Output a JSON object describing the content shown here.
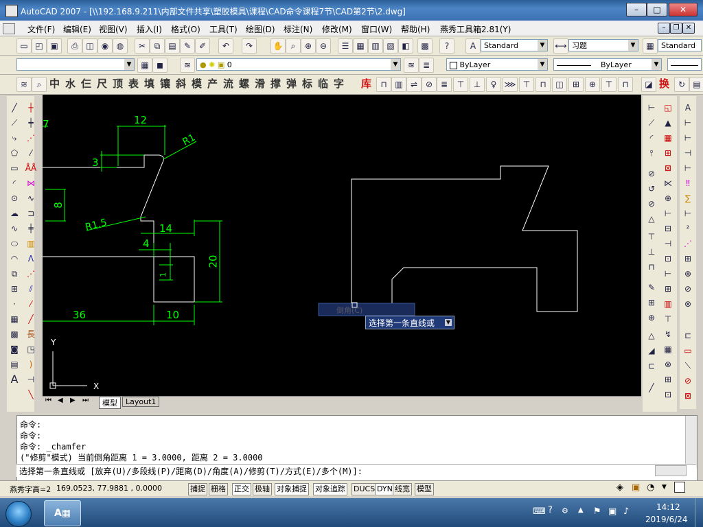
{
  "window": {
    "title": "AutoCAD 2007 - [\\\\192.168.9.211\\内部文件共享\\塑胶模具\\课程\\CAD命令课程7节\\CAD第2节\\2.dwg]"
  },
  "menubar": {
    "items": [
      "文件(F)",
      "编辑(E)",
      "视图(V)",
      "插入(I)",
      "格式(O)",
      "工具(T)",
      "绘图(D)",
      "标注(N)",
      "修改(M)",
      "窗口(W)",
      "帮助(H)",
      "燕秀工具箱2.81(Y)"
    ]
  },
  "toolbar_styles": {
    "text_style": "Standard",
    "dim_style": "习题",
    "table_style": "Standard"
  },
  "toolbar_layers": {
    "layer_value": "0",
    "color": "ByLayer",
    "linetype": "ByLayer",
    "lineweight": ""
  },
  "yanxiu_toolbar": {
    "chars": [
      "中",
      "水",
      "仨",
      "尺",
      "顶",
      "表",
      "填",
      "镶",
      "斜",
      "模",
      "产",
      "流",
      "螺",
      "滑",
      "撑",
      "弹",
      "标",
      "临",
      "字"
    ],
    "red_char_1": "库",
    "red_char_2": "换"
  },
  "drawing": {
    "dims": {
      "d7": "7",
      "d12": "12",
      "r1": "R1",
      "d3": "3",
      "d8": "8",
      "r15": "R1.5",
      "d14": "14",
      "d4": "4",
      "d20": "20",
      "d36": "36",
      "d10": "10",
      "d1": "1"
    },
    "ucs": {
      "x": "X",
      "y": "Y"
    },
    "tooltip_partial": "倒角(C)",
    "prompt_tooltip": "选择第一条直线或"
  },
  "layout_tabs": [
    "模型",
    "Layout1"
  ],
  "command": {
    "lines": [
      "命令:",
      "命令:",
      "命令: _chamfer",
      "(\"修剪\"模式) 当前倒角距离 1 = 3.0000, 距离 2 = 3.0000"
    ],
    "input": "选择第一条直线或 [放弃(U)/多段线(P)/距离(D)/角度(A)/修剪(T)/方式(E)/多个(M)]:"
  },
  "status": {
    "label": "燕秀字高=2",
    "coords": "169.0523, 77.9881 , 0.0000",
    "buttons": [
      "捕捉",
      "栅格",
      "正交",
      "极轴",
      "对象捕捉",
      "对象追踪",
      "DUCS",
      "DYN",
      "线宽",
      "模型"
    ]
  },
  "taskbar": {
    "time": "14:12",
    "date": "2019/6/24"
  }
}
